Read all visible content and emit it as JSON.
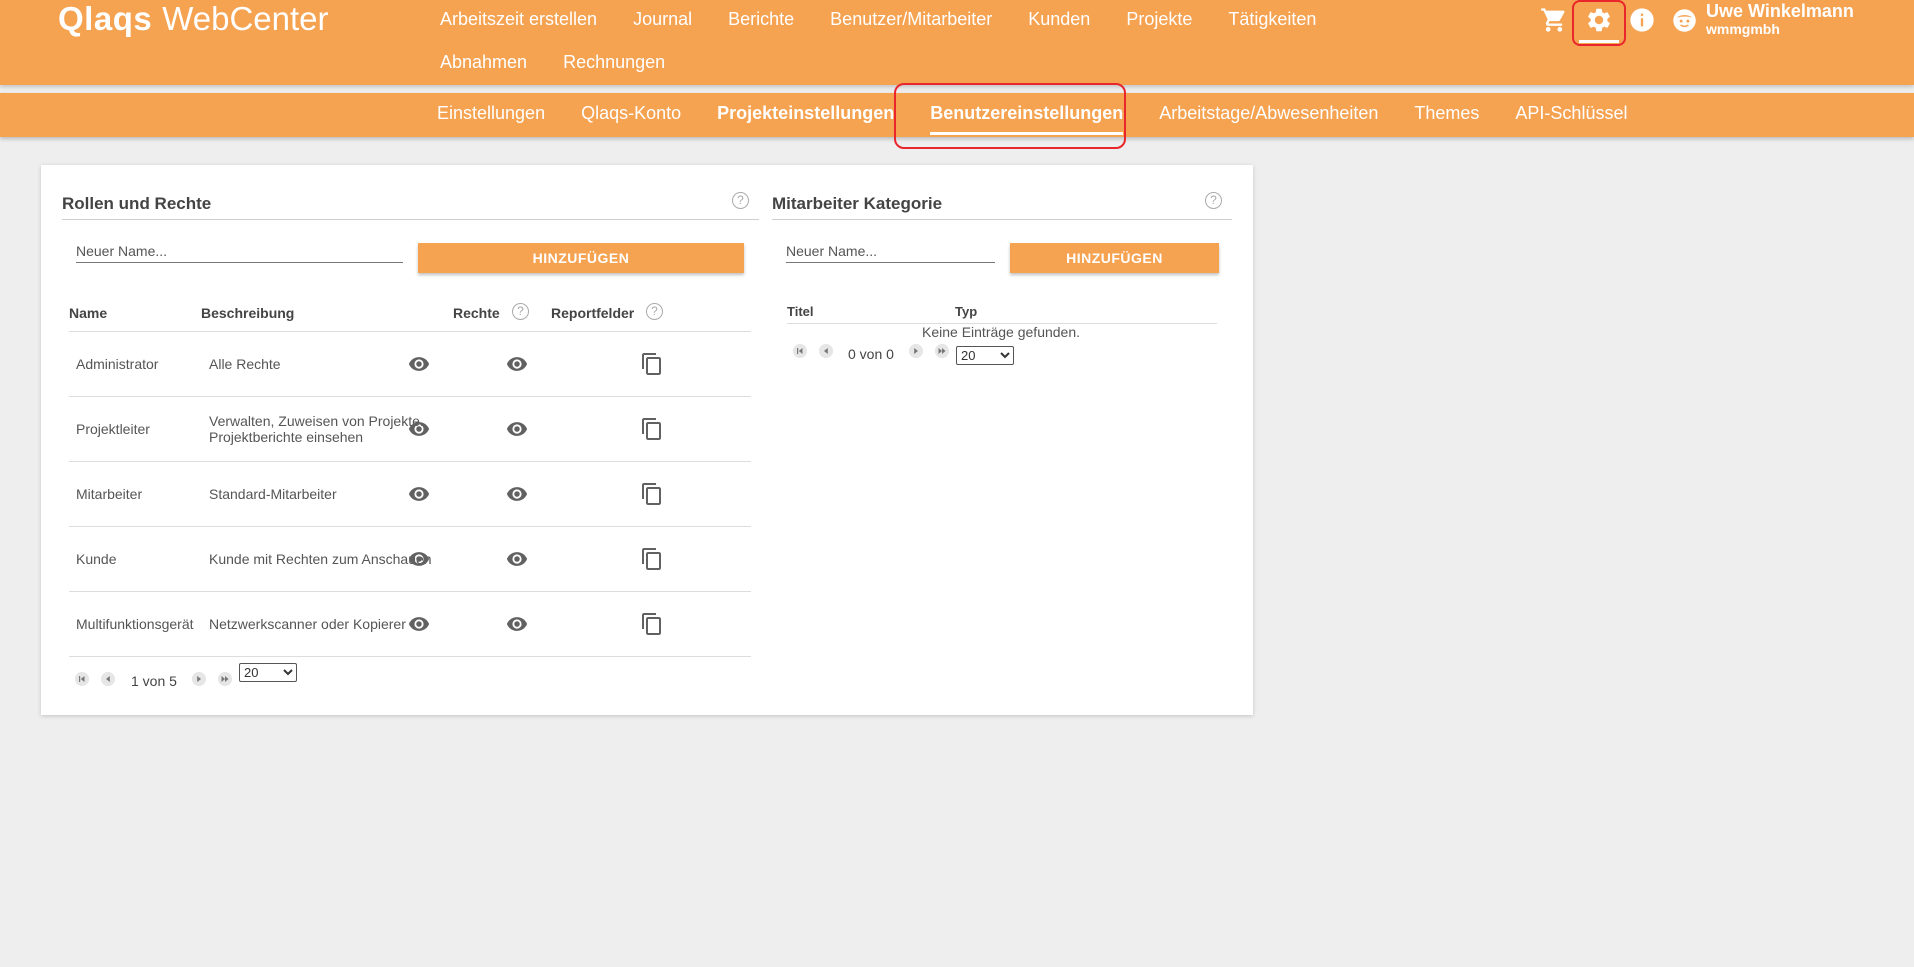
{
  "app": {
    "brand": "Qlaqs",
    "product": "WebCenter"
  },
  "main_nav": [
    {
      "label": "Arbeitszeit erstellen"
    },
    {
      "label": "Journal"
    },
    {
      "label": "Berichte"
    },
    {
      "label": "Benutzer/Mitarbeiter"
    },
    {
      "label": "Kunden"
    },
    {
      "label": "Projekte"
    },
    {
      "label": "Tätigkeiten"
    },
    {
      "label": "Abnahmen"
    },
    {
      "label": "Rechnungen"
    }
  ],
  "top_icons": [
    "cart-icon",
    "gear-icon",
    "info-icon",
    "avatar-icon"
  ],
  "user": {
    "name": "Uwe Winkelmann",
    "company": "wmmgmbh"
  },
  "sub_nav": [
    {
      "label": "Einstellungen"
    },
    {
      "label": "Qlaqs-Konto"
    },
    {
      "label": "Projekteinstellungen"
    },
    {
      "label": "Benutzereinstellungen",
      "active": true
    },
    {
      "label": "Arbeitstage/Abwesenheiten"
    },
    {
      "label": "Themes"
    },
    {
      "label": "API-Schlüssel"
    }
  ],
  "roles": {
    "title": "Rollen und Rechte",
    "help": "?",
    "input_placeholder": "Neuer Name...",
    "add_label": "HINZUFÜGEN",
    "columns": [
      "Name",
      "Beschreibung",
      "Rechte",
      "Reportfelder"
    ],
    "rows": [
      {
        "name": "Administrator",
        "description": "Alle Rechte"
      },
      {
        "name": "Projektleiter",
        "description": "Verwalten, Zuweisen von Projekte. Projektberichte einsehen"
      },
      {
        "name": "Mitarbeiter",
        "description": "Standard-Mitarbeiter"
      },
      {
        "name": "Kunde",
        "description": "Kunde mit Rechten zum Anschauen"
      },
      {
        "name": "Multifunktionsgerät",
        "description": "Netzwerkscanner oder Kopierer"
      }
    ],
    "pagination": {
      "text": "1 von 5",
      "page_size": "20",
      "page_size_options": [
        "20"
      ]
    }
  },
  "category": {
    "title": "Mitarbeiter Kategorie",
    "help": "?",
    "input_placeholder": "Neuer Name...",
    "add_label": "HINZUFÜGEN",
    "columns": [
      "Titel",
      "Typ"
    ],
    "empty_message": "Keine Einträge gefunden.",
    "pagination": {
      "text": "0 von 0",
      "page_size": "20",
      "page_size_options": [
        "20"
      ]
    }
  },
  "colors": {
    "accent": "#f5a251",
    "highlight": "#e8262b",
    "background": "#eeeeee"
  }
}
